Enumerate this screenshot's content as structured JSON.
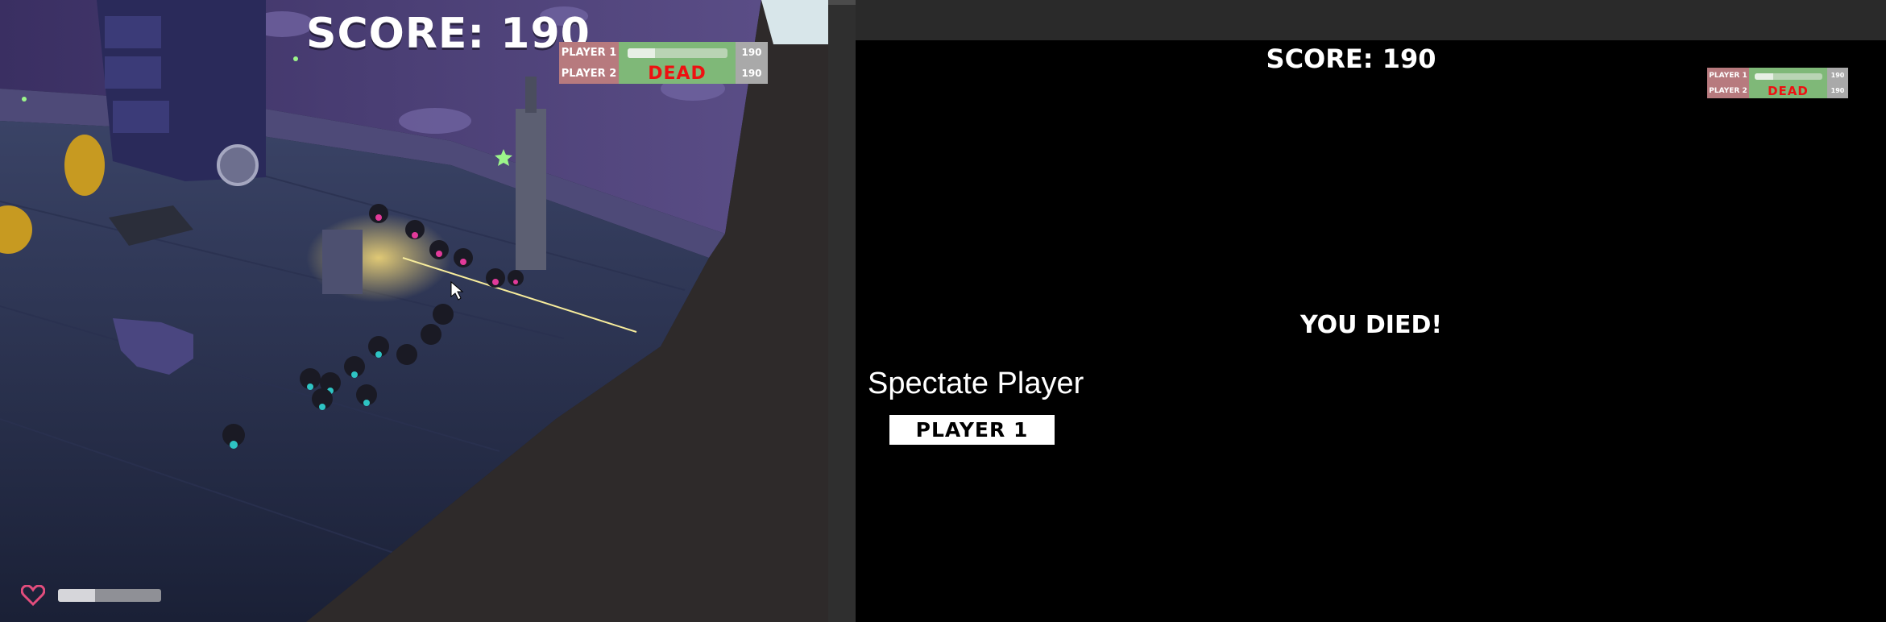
{
  "left_view": {
    "score_text": "SCORE: 190",
    "players": [
      {
        "name": "PLAYER 1",
        "status": "health-bar",
        "health_fraction": 0.28,
        "score": "190"
      },
      {
        "name": "PLAYER 2",
        "status": "DEAD",
        "score": "190"
      }
    ],
    "hud": {
      "heart_icon": "heart-outline-icon",
      "heart_color": "#e24d7d",
      "health_fraction": 0.36
    }
  },
  "right_view": {
    "score_text": "SCORE: 190",
    "players": [
      {
        "name": "PLAYER 1",
        "status": "health-bar",
        "health_fraction": 0.28,
        "score": "190"
      },
      {
        "name": "PLAYER 2",
        "status": "DEAD",
        "score": "190"
      }
    ],
    "message": "YOU DIED!",
    "spectate": {
      "heading": "Spectate Player",
      "button_label": "PLAYER 1"
    }
  },
  "colors": {
    "name_cell": "#b77a7e",
    "status_cell": "#7fb878",
    "score_cell": "#a9a9a9",
    "dead_text": "#ee1111",
    "enemy_accent": "#e23a9a",
    "ally_accent": "#2ec4c4"
  }
}
